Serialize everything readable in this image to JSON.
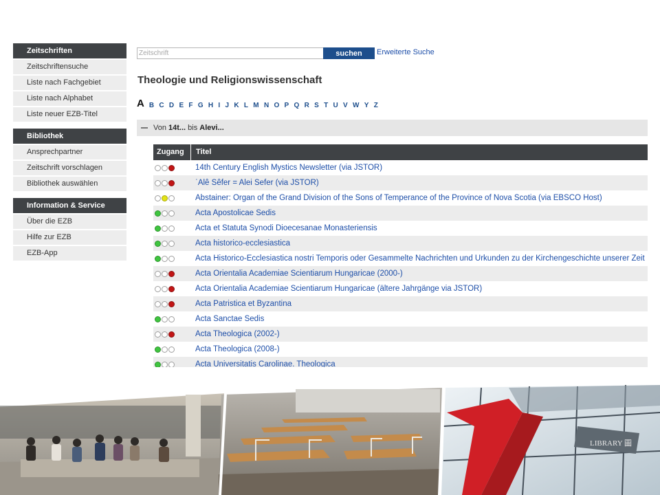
{
  "sidebar": {
    "blocks": [
      {
        "title": "Zeitschriften",
        "items": [
          "Zeitschriftensuche",
          "Liste nach Fachgebiet",
          "Liste nach Alphabet",
          "Liste neuer EZB-Titel"
        ]
      },
      {
        "title": "Bibliothek",
        "items": [
          "Ansprechpartner",
          "Zeitschrift vorschlagen",
          "Bibliothek auswählen"
        ]
      },
      {
        "title": "Information & Service",
        "items": [
          "Über die EZB",
          "Hilfe zur EZB",
          "EZB-App"
        ]
      }
    ]
  },
  "search": {
    "placeholder": "Zeitschrift",
    "value": "",
    "button_label": "suchen",
    "advanced_link": "Erweiterte Suche"
  },
  "page_title": "Theologie und Religionswissenschaft",
  "alphabet": {
    "letters": [
      "A",
      "B",
      "C",
      "D",
      "E",
      "F",
      "G",
      "H",
      "I",
      "J",
      "K",
      "L",
      "M",
      "N",
      "O",
      "P",
      "Q",
      "R",
      "S",
      "T",
      "U",
      "V",
      "W",
      "Y",
      "Z"
    ],
    "active": "A"
  },
  "range": {
    "von_label": "Von",
    "from": "14t...",
    "bis_label": "bis",
    "to": "Alevi..."
  },
  "table": {
    "headers": {
      "access": "Zugang",
      "title": "Titel"
    },
    "rows": [
      {
        "access": "red",
        "title": "14th Century English Mystics Newsletter (via JSTOR)"
      },
      {
        "access": "red",
        "title": "ʿAlê Sêfer = Alei Sefer (via JSTOR)"
      },
      {
        "access": "yellow",
        "title": "Abstainer: Organ of the Grand Division of the Sons of Temperance of the Province of Nova Scotia (via EBSCO Host)"
      },
      {
        "access": "green",
        "title": "Acta Apostolicae Sedis"
      },
      {
        "access": "green",
        "title": "Acta et Statuta Synodi Dioecesanae Monasteriensis"
      },
      {
        "access": "green",
        "title": "Acta historico-ecclesiastica"
      },
      {
        "access": "green",
        "title": "Acta Historico-Ecclesiastica nostri Temporis oder Gesammelte Nachrichten und Urkunden zu der Kirchengeschichte unserer Zeit"
      },
      {
        "access": "red",
        "title": "Acta Orientalia Academiae Scientiarum Hungaricae (2000-)"
      },
      {
        "access": "red",
        "title": "Acta Orientalia Academiae Scientiarum Hungaricae (ältere Jahrgänge via JSTOR)"
      },
      {
        "access": "red",
        "title": "Acta Patristica et Byzantina"
      },
      {
        "access": "green",
        "title": "Acta Sanctae Sedis"
      },
      {
        "access": "red",
        "title": "Acta Theologica (2002-)"
      },
      {
        "access": "green",
        "title": "Acta Theologica (2008-)"
      },
      {
        "access": "green",
        "title": "Acta Universitatis Carolinae. Theologica"
      }
    ]
  },
  "banner": {
    "library_sign": "LIBRARY 圖"
  },
  "colors": {
    "header_dark": "#3f4245",
    "link_blue": "#1d4ea8",
    "button_blue": "#1d4e8c",
    "light_red": "#c21515",
    "light_yellow": "#e3e316",
    "light_green": "#3fc53f",
    "accent_red": "#d01f26"
  }
}
